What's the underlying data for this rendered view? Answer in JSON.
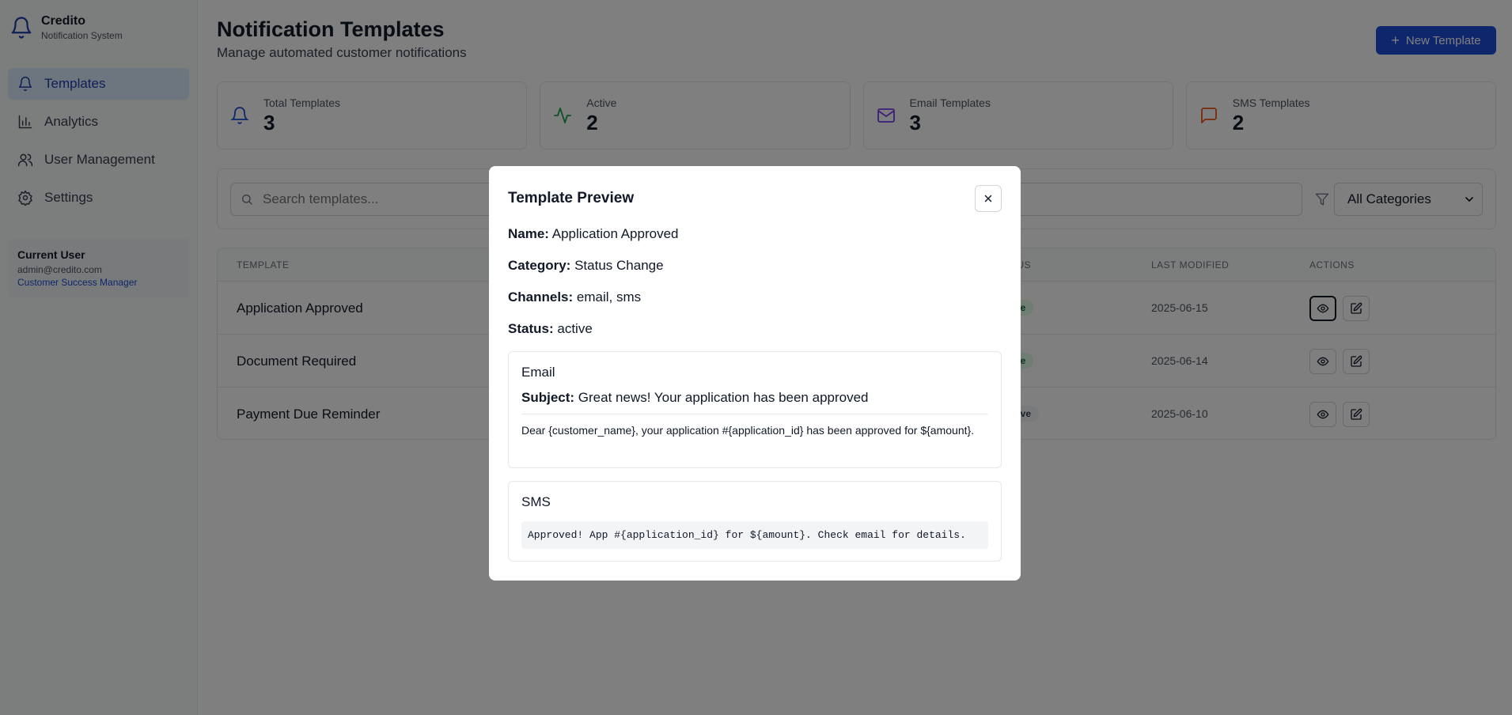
{
  "brand": {
    "title": "Credito",
    "subtitle": "Notification System"
  },
  "sidebar": {
    "items": [
      {
        "label": "Templates",
        "icon": "bell-icon",
        "active": true
      },
      {
        "label": "Analytics",
        "icon": "bar-chart-icon"
      },
      {
        "label": "User Management",
        "icon": "users-icon"
      },
      {
        "label": "Settings",
        "icon": "gear-icon"
      }
    ],
    "user": {
      "title": "Current User",
      "email": "admin@credito.com",
      "role": "Customer Success Manager"
    }
  },
  "header": {
    "title": "Notification Templates",
    "subtitle": "Manage automated customer notifications",
    "new_button": "New Template"
  },
  "stats": [
    {
      "label": "Total Templates",
      "value": "3",
      "icon": "bell-icon",
      "color": "#1d4ed8"
    },
    {
      "label": "Active",
      "value": "2",
      "icon": "activity-icon",
      "color": "#16a34a"
    },
    {
      "label": "Email Templates",
      "value": "3",
      "icon": "mail-icon",
      "color": "#7c3aed"
    },
    {
      "label": "SMS Templates",
      "value": "2",
      "icon": "message-icon",
      "color": "#ea580c"
    }
  ],
  "filters": {
    "search_placeholder": "Search templates...",
    "category": "All Categories"
  },
  "table": {
    "headers": {
      "template": "TEMPLATE",
      "status": "ATUS",
      "last_modified": "LAST MODIFIED",
      "actions": "ACTIONS"
    },
    "rows": [
      {
        "name": "Application Approved",
        "status": "ctive",
        "date": "2025-06-15"
      },
      {
        "name": "Document Required",
        "status": "ctive",
        "date": "2025-06-14"
      },
      {
        "name": "Payment Due Reminder",
        "status": "active",
        "date": "2025-06-10"
      }
    ]
  },
  "modal": {
    "title": "Template Preview",
    "name_label": "Name:",
    "name": "Application Approved",
    "category_label": "Category:",
    "category": "Status Change",
    "channels_label": "Channels:",
    "channels": "email, sms",
    "status_label": "Status:",
    "status": "active",
    "email": {
      "title": "Email",
      "subject_label": "Subject:",
      "subject": "Great news! Your application has been approved",
      "body": "Dear {customer_name}, your application #{application_id} has been approved for ${amount}."
    },
    "sms": {
      "title": "SMS",
      "body": "Approved! App #{application_id} for ${amount}. Check email for details."
    }
  }
}
